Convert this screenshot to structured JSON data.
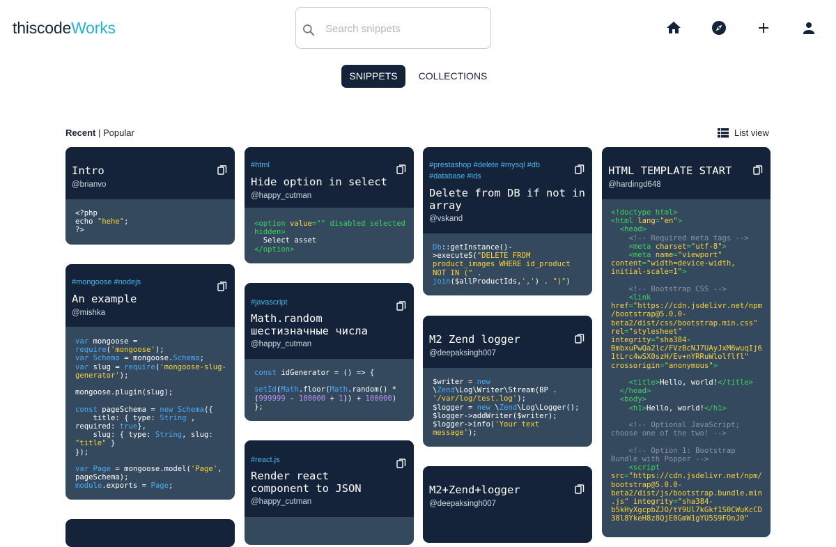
{
  "header": {
    "logo_part1": "thiscode",
    "logo_part2": "Works",
    "search_placeholder": "Search snippets",
    "icons": [
      "home-icon",
      "explore-icon",
      "plus-icon",
      "account-icon"
    ]
  },
  "tabs": [
    {
      "label": "SNIPPETS",
      "active": true
    },
    {
      "label": "COLLECTIONS",
      "active": false
    }
  ],
  "filters": {
    "recent": "Recent",
    "separator": " | ",
    "popular": "Popular"
  },
  "list_view_label": "List view",
  "cards": [
    {
      "tags": "",
      "title": "Intro",
      "author": "@brianvo"
    },
    {
      "tags": "#mongoose #nodejs",
      "title": "An example",
      "author": "@mishka"
    },
    {
      "tags": "#html",
      "title": "Hide option in select",
      "author": "@happy_cutman"
    },
    {
      "tags": "#javascript",
      "title": "Math.random\nшестизначные числа",
      "author": "@happy_cutman"
    },
    {
      "tags": "#react.js",
      "title": "Render react\ncomponent to JSON",
      "author": "@happy_cutman"
    },
    {
      "tags": "#prestashop #delete #mysql #db\n#database #ids",
      "title": "Delete from DB if not in\narray",
      "author": "@vskand"
    },
    {
      "tags": "",
      "title": "M2 Zend logger",
      "author": "@deepaksingh007"
    },
    {
      "tags": "",
      "title": "M2+Zend+logger",
      "author": "@deepaksingh007"
    },
    {
      "tags": "",
      "title": "HTML TEMPLATE START",
      "author": "@hardingd648"
    }
  ],
  "code": {
    "c0": [
      [
        [
          "",
          "<?php"
        ]
      ],
      [
        [
          "",
          "echo "
        ],
        [
          "st",
          "\"hehe\""
        ],
        [
          "",
          ";"
        ]
      ],
      [
        [
          "",
          "?>"
        ]
      ]
    ],
    "c1": [
      [
        [
          "kw",
          "var"
        ],
        [
          "",
          " mongoose ="
        ]
      ],
      [
        [
          "kw",
          "require"
        ],
        [
          "",
          "("
        ],
        [
          "st",
          "'mongoose'"
        ],
        [
          "",
          ");"
        ]
      ],
      [
        [
          "kw",
          "var"
        ],
        [
          "",
          " "
        ],
        [
          "kw",
          "Schema"
        ],
        [
          "",
          " = mongoose."
        ],
        [
          "kw",
          "Schema"
        ],
        [
          "",
          ";"
        ]
      ],
      [
        [
          "kw",
          "var"
        ],
        [
          "",
          " slug = "
        ],
        [
          "kw",
          "require"
        ],
        [
          "",
          "("
        ],
        [
          "st",
          "'mongoose-slug-"
        ]
      ],
      [
        [
          "st",
          "generator'"
        ],
        [
          "",
          ");"
        ]
      ],
      [
        [
          "",
          ""
        ]
      ],
      [
        [
          "",
          "mongoose.plugin(slug);"
        ]
      ],
      [
        [
          "",
          ""
        ]
      ],
      [
        [
          "kw",
          "const"
        ],
        [
          "",
          " pageSchema = "
        ],
        [
          "kw",
          "new"
        ],
        [
          "",
          " "
        ],
        [
          "kw",
          "Schema"
        ],
        [
          "",
          "({"
        ]
      ],
      [
        [
          "",
          "    title: { type: "
        ],
        [
          "kw",
          "String"
        ],
        [
          "",
          " ,"
        ]
      ],
      [
        [
          "",
          "required: "
        ],
        [
          "kw",
          "true"
        ],
        [
          "",
          "},"
        ]
      ],
      [
        [
          "",
          "    slug: { type: "
        ],
        [
          "kw",
          "String"
        ],
        [
          "",
          ", slug:"
        ]
      ],
      [
        [
          "st",
          "\"title\""
        ],
        [
          "",
          " }"
        ]
      ],
      [
        [
          "",
          "});"
        ]
      ],
      [
        [
          "",
          ""
        ]
      ],
      [
        [
          "kw",
          "var"
        ],
        [
          "",
          " "
        ],
        [
          "kw",
          "Page"
        ],
        [
          "",
          " = mongoose.model("
        ],
        [
          "st",
          "'Page'"
        ],
        [
          "",
          ","
        ]
      ],
      [
        [
          "",
          "pageSchema);"
        ]
      ],
      [
        [
          "kw",
          "module"
        ],
        [
          "",
          ".exports = "
        ],
        [
          "kw",
          "Page"
        ],
        [
          "",
          ";"
        ]
      ]
    ],
    "c2": [
      [
        [
          "tg",
          "<option "
        ],
        [
          "at",
          "value"
        ],
        [
          "tg",
          "=\"\" disabled selected"
        ]
      ],
      [
        [
          "tg",
          "hidden>"
        ]
      ],
      [
        [
          "",
          "  Select asset"
        ]
      ],
      [
        [
          "tg",
          "</option>"
        ]
      ]
    ],
    "c3": [
      [
        [
          "kw",
          "const"
        ],
        [
          "",
          " idGenerator = () => {"
        ]
      ],
      [
        [
          "",
          ""
        ]
      ],
      [
        [
          "fn",
          "setId"
        ],
        [
          "",
          "("
        ],
        [
          "kw",
          "Math"
        ],
        [
          "",
          ".floor("
        ],
        [
          "kw",
          "Math"
        ],
        [
          "",
          ".random() *"
        ]
      ],
      [
        [
          "",
          "("
        ],
        [
          "nm",
          "999999"
        ],
        [
          "",
          " - "
        ],
        [
          "nm",
          "100000"
        ],
        [
          "",
          " + "
        ],
        [
          "nm",
          "1"
        ],
        [
          "",
          ")) + "
        ],
        [
          "nm",
          "100000"
        ],
        [
          "",
          ")"
        ]
      ],
      [
        [
          "",
          "};"
        ]
      ]
    ],
    "c5": [
      [
        [
          "kw",
          "Db"
        ],
        [
          "",
          "::getInstance()-"
        ]
      ],
      [
        [
          "",
          ">executeS("
        ],
        [
          "st",
          "\"DELETE FROM"
        ]
      ],
      [
        [
          "st",
          "product_images WHERE id_product"
        ]
      ],
      [
        [
          "st",
          "NOT IN (\""
        ],
        [
          "",
          " ."
        ]
      ],
      [
        [
          "kw",
          "join"
        ],
        [
          "",
          "($allProductIds,"
        ],
        [
          "st",
          "','"
        ],
        [
          "",
          ") . "
        ],
        [
          "st",
          "\")\""
        ],
        [
          "",
          ")"
        ]
      ]
    ],
    "c6": [
      [
        [
          "",
          "$writer = "
        ],
        [
          "kw",
          "new"
        ]
      ],
      [
        [
          "",
          "\\"
        ],
        [
          "kw",
          "Zend"
        ],
        [
          "",
          "\\Log\\Writer\\Stream(BP ."
        ]
      ],
      [
        [
          "st",
          "'/var/log/test.log'"
        ],
        [
          "",
          ");"
        ]
      ],
      [
        [
          "",
          "$logger = "
        ],
        [
          "kw",
          "new"
        ],
        [
          "",
          " \\"
        ],
        [
          "kw",
          "Zend"
        ],
        [
          "",
          "\\Log\\Logger();"
        ]
      ],
      [
        [
          "",
          "$logger->addWriter($writer);"
        ]
      ],
      [
        [
          "",
          "$logger->info("
        ],
        [
          "st",
          "'Your text"
        ]
      ],
      [
        [
          "st",
          "message'"
        ],
        [
          "",
          ");"
        ]
      ]
    ],
    "c8": [
      [
        [
          "tg",
          "<!doctype html>"
        ]
      ],
      [
        [
          "tg",
          "<html "
        ],
        [
          "at",
          "lang"
        ],
        [
          "tg",
          "="
        ],
        [
          "st",
          "\"en\""
        ],
        [
          "tg",
          ">"
        ]
      ],
      [
        [
          "tg",
          "  <head>"
        ]
      ],
      [
        [
          "cm",
          "    <!-- Required meta tags -->"
        ]
      ],
      [
        [
          "tg",
          "    <meta "
        ],
        [
          "at",
          "charset"
        ],
        [
          "tg",
          "="
        ],
        [
          "st",
          "\"utf-8\""
        ],
        [
          "tg",
          ">"
        ]
      ],
      [
        [
          "tg",
          "    <meta "
        ],
        [
          "at",
          "name"
        ],
        [
          "tg",
          "="
        ],
        [
          "st",
          "\"viewport\""
        ]
      ],
      [
        [
          "at",
          "content"
        ],
        [
          "tg",
          "="
        ],
        [
          "st",
          "\"width=device-width,"
        ]
      ],
      [
        [
          "st",
          "initial-scale=1\""
        ],
        [
          "tg",
          ">"
        ]
      ],
      [
        [
          "",
          ""
        ]
      ],
      [
        [
          "cm",
          "    <!-- Bootstrap CSS -->"
        ]
      ],
      [
        [
          "tg",
          "    <link"
        ]
      ],
      [
        [
          "at",
          "href"
        ],
        [
          "tg",
          "="
        ],
        [
          "st",
          "\"https://cdn.jsdelivr.net/npm"
        ]
      ],
      [
        [
          "st",
          "/bootstrap@5.0.0-"
        ]
      ],
      [
        [
          "st",
          "beta2/dist/css/bootstrap.min.css\""
        ]
      ],
      [
        [
          "at",
          "rel"
        ],
        [
          "tg",
          "="
        ],
        [
          "st",
          "\"stylesheet\""
        ]
      ],
      [
        [
          "at",
          "integrity"
        ],
        [
          "tg",
          "="
        ],
        [
          "st",
          "\"sha384-"
        ]
      ],
      [
        [
          "st",
          "BmbxuPwQa2lc/FVzBcNJ7UAyJxM6wuqIj6"
        ]
      ],
      [
        [
          "st",
          "1tLrc4wSX0szH/Ev+nYRRuWlolflfl\""
        ]
      ],
      [
        [
          "at",
          "crossorigin"
        ],
        [
          "tg",
          "="
        ],
        [
          "st",
          "\"anonymous\""
        ],
        [
          "tg",
          ">"
        ]
      ],
      [
        [
          "",
          ""
        ]
      ],
      [
        [
          "tg",
          "    <title>"
        ],
        [
          "",
          "Hello, world!"
        ],
        [
          "tg",
          "</title>"
        ]
      ],
      [
        [
          "tg",
          "  </head>"
        ]
      ],
      [
        [
          "tg",
          "  <body>"
        ]
      ],
      [
        [
          "tg",
          "    <h1>"
        ],
        [
          "",
          "Hello, world!"
        ],
        [
          "tg",
          "</h1>"
        ]
      ],
      [
        [
          "",
          ""
        ]
      ],
      [
        [
          "cm",
          "    <!-- Optional JavaScript;"
        ]
      ],
      [
        [
          "cm",
          "choose one of the two! -->"
        ]
      ],
      [
        [
          "",
          ""
        ]
      ],
      [
        [
          "cm",
          "    <!-- Option 1: Bootstrap"
        ]
      ],
      [
        [
          "cm",
          "Bundle with Popper -->"
        ]
      ],
      [
        [
          "tg",
          "    <script"
        ]
      ],
      [
        [
          "at",
          "src"
        ],
        [
          "tg",
          "="
        ],
        [
          "st",
          "\"https://cdn.jsdelivr.net/npm/"
        ]
      ],
      [
        [
          "st",
          "bootstrap@5.0.0-"
        ]
      ],
      [
        [
          "st",
          "beta2/dist/js/bootstrap.bundle.min"
        ]
      ],
      [
        [
          "st",
          ".js\""
        ],
        [
          "",
          " "
        ],
        [
          "at",
          "integrity"
        ],
        [
          "tg",
          "="
        ],
        [
          "st",
          "\"sha384-"
        ]
      ],
      [
        [
          "st",
          "b5kHyXgcpbZJO/tY9Ul7kGkf1S0CWuKcCD"
        ]
      ],
      [
        [
          "st",
          "38l8YkeH8z8QjE0GmW1gYU5S9FOnJ0\""
        ]
      ]
    ]
  }
}
